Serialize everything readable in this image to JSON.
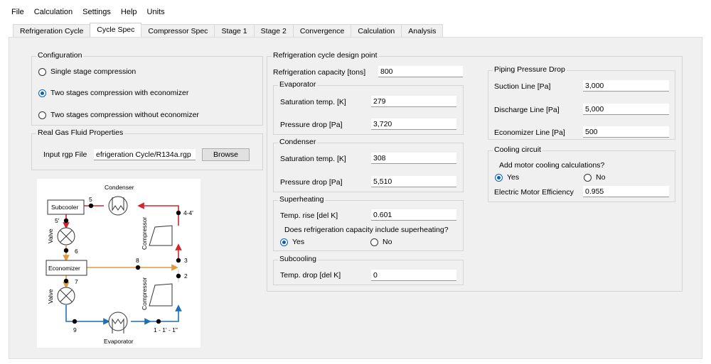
{
  "menu": [
    "File",
    "Calculation",
    "Settings",
    "Help",
    "Units"
  ],
  "tabs": [
    "Refrigeration Cycle",
    "Cycle Spec",
    "Compressor Spec",
    "Stage 1",
    "Stage 2",
    "Convergence",
    "Calculation",
    "Analysis"
  ],
  "active_tab": "Cycle Spec",
  "configuration": {
    "title": "Configuration",
    "options": [
      "Single stage compression",
      "Two stages compression with economizer",
      "Two stages compression without economizer"
    ],
    "selected": 1
  },
  "rgp": {
    "title": "Real Gas Fluid Properties",
    "label": "Input rgp File",
    "value": "efrigeration Cycle/R134a.rgp",
    "browse": "Browse"
  },
  "diagram": {
    "condenser": "Condenser",
    "subcooler": "Subcooler",
    "economizer": "Economizer",
    "evaporator": "Evaporator",
    "valve": "Valve",
    "compressor": "Compressor",
    "points": [
      "5",
      "5'",
      "6",
      "7",
      "8",
      "9",
      "4-4'",
      "3",
      "2",
      "1 - 1' - 1\""
    ],
    "colors": {
      "hot": "#d0262c",
      "mid": "#e29a3c",
      "cold": "#1f6fb4"
    }
  },
  "design": {
    "title": "Refrigeration cycle design point",
    "capacity_label": "Refrigeration capacity  [tons]",
    "capacity": "800",
    "evaporator": {
      "title": "Evaporator",
      "sat_label": "Saturation temp.  [K]",
      "sat": "279",
      "dp_label": "Pressure drop  [Pa]",
      "dp": "3,720"
    },
    "condenser": {
      "title": "Condenser",
      "sat_label": "Saturation temp.  [K]",
      "sat": "308",
      "dp_label": "Pressure drop  [Pa]",
      "dp": "5,510"
    },
    "superheating": {
      "title": "Superheating",
      "rise_label": "Temp. rise  [del K]",
      "rise": "0.601",
      "question": "Does refrigeration capacity include superheating?",
      "yes": "Yes",
      "no": "No"
    },
    "subcooling": {
      "title": "Subcooling",
      "drop_label": "Temp. drop  [del K]",
      "drop": "0"
    }
  },
  "piping": {
    "title": "Piping Pressure Drop",
    "suction_label": "Suction Line  [Pa]",
    "suction": "3,000",
    "discharge_label": "Discharge Line  [Pa]",
    "discharge": "5,000",
    "economizer_label": "Economizer Line  [Pa]",
    "economizer": "500"
  },
  "cooling": {
    "title": "Cooling circuit",
    "question": "Add motor cooling calculations?",
    "yes": "Yes",
    "no": "No",
    "eff_label": "Electric Motor Efficiency",
    "eff": "0.955"
  }
}
